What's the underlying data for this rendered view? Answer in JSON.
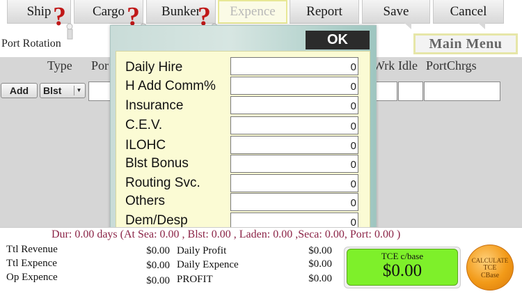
{
  "tabs": [
    {
      "label": "Ship",
      "selected": false
    },
    {
      "label": "Cargo",
      "selected": false
    },
    {
      "label": "Bunker",
      "selected": false
    },
    {
      "label": "Expence",
      "selected": true
    },
    {
      "label": "Report",
      "selected": false
    },
    {
      "label": "Save",
      "selected": false
    },
    {
      "label": "Cancel",
      "selected": false
    }
  ],
  "header": {
    "port_rotation": "Port Rotation",
    "main_menu": "Main Menu"
  },
  "grid": {
    "columns": [
      "Type",
      "Por",
      "Wrk",
      "Idle",
      "PortChrgs"
    ],
    "add_label": "Add",
    "type_value": "Blst"
  },
  "dialog": {
    "ok_label": "OK",
    "items": [
      {
        "label": "Daily Hire",
        "value": "0"
      },
      {
        "label": "H Add Comm%",
        "value": "0"
      },
      {
        "label": "Insurance",
        "value": "0"
      },
      {
        "label": "C.E.V.",
        "value": "0"
      },
      {
        "label": "ILOHC",
        "value": "0"
      },
      {
        "label": "Blst Bonus",
        "value": "0"
      },
      {
        "label": "Routing Svc.",
        "value": "0"
      },
      {
        "label": "Others",
        "value": "0"
      },
      {
        "label": "Dem/Desp",
        "value": "0"
      }
    ]
  },
  "summary": {
    "duration": "Dur: 0.00 days (At Sea: 0.00 , Blst: 0.00 , Laden: 0.00 ,Seca: 0.00, Port: 0.00 )",
    "left": [
      {
        "label": "Ttl Revenue",
        "value": "$0.00"
      },
      {
        "label": "Ttl Expence",
        "value": "$0.00"
      },
      {
        "label": "Op Expence",
        "value": "$0.00"
      }
    ],
    "right": [
      {
        "label": "Daily Profit",
        "value": "$0.00"
      },
      {
        "label": "Daily Expence",
        "value": "$0.00"
      },
      {
        "label": "PROFIT",
        "value": "$0.00"
      }
    ],
    "tce_label": "TCE c/base",
    "tce_value": "$0.00",
    "calc_lines": [
      "CALCULATE",
      "TCE",
      "CBase"
    ]
  },
  "colors": {
    "accent_green": "#7ef02a",
    "calc_orange": "#f29a18",
    "duration_text": "#8b2346"
  },
  "icons": [
    "help-question-icon"
  ]
}
